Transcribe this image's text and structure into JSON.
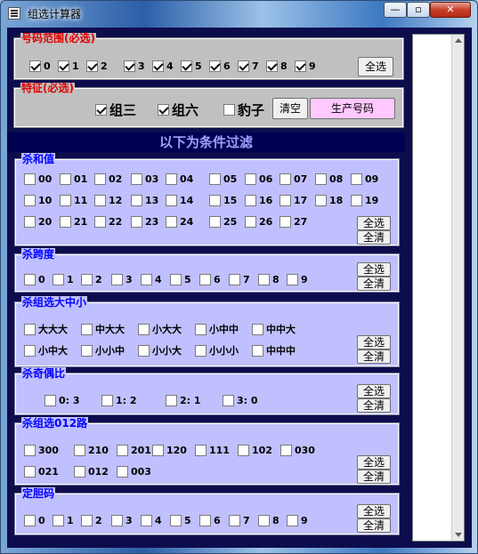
{
  "window": {
    "title": "组选计算器",
    "min_icon": "minimize-icon",
    "max_icon": "maximize-icon",
    "close_icon": "close-icon",
    "min_glyph": "—",
    "max_glyph": "▫",
    "close_glyph": "✕"
  },
  "number_range": {
    "legend": "号码范围(必选)",
    "items": [
      {
        "label": "0",
        "checked": true
      },
      {
        "label": "1",
        "checked": true
      },
      {
        "label": "2",
        "checked": true
      },
      {
        "label": "3",
        "checked": true
      },
      {
        "label": "4",
        "checked": true
      },
      {
        "label": "5",
        "checked": true
      },
      {
        "label": "6",
        "checked": true
      },
      {
        "label": "7",
        "checked": true
      },
      {
        "label": "8",
        "checked": true
      },
      {
        "label": "9",
        "checked": true
      }
    ],
    "select_all": "全选"
  },
  "feature": {
    "legend": "特征(必选)",
    "items": [
      {
        "label": "组三",
        "checked": true
      },
      {
        "label": "组六",
        "checked": true
      },
      {
        "label": "豹子",
        "checked": false
      }
    ],
    "clear": "清空",
    "generate": "生产号码"
  },
  "filter_header": "以下为条件过滤",
  "sum": {
    "legend": "杀和值",
    "items": [
      "00",
      "01",
      "02",
      "03",
      "04",
      "05",
      "06",
      "07",
      "08",
      "09",
      "10",
      "11",
      "12",
      "13",
      "14",
      "15",
      "16",
      "17",
      "18",
      "19",
      "20",
      "21",
      "22",
      "23",
      "24",
      "25",
      "26",
      "27"
    ],
    "select_all": "全选",
    "clear_all": "全清"
  },
  "span": {
    "legend": "杀跨度",
    "items": [
      "0",
      "1",
      "2",
      "3",
      "4",
      "5",
      "6",
      "7",
      "8",
      "9"
    ],
    "select_all": "全选",
    "clear_all": "全清"
  },
  "size": {
    "legend": "杀组选大中小",
    "row1": [
      "大大大",
      "中大大",
      "小大大",
      "小中中",
      "中中大"
    ],
    "row2": [
      "小中大",
      "小小中",
      "小小大",
      "小小小",
      "中中中"
    ],
    "select_all": "全选",
    "clear_all": "全清"
  },
  "parity": {
    "legend": "杀奇偶比",
    "items": [
      "0: 3",
      "1: 2",
      "2: 1",
      "3: 0"
    ],
    "select_all": "全选",
    "clear_all": "全清"
  },
  "route": {
    "legend": "杀组选012路",
    "row1": [
      "300",
      "210",
      "201",
      "120",
      "111",
      "102",
      "030"
    ],
    "row2": [
      "021",
      "012",
      "003"
    ],
    "select_all": "全选",
    "clear_all": "全清"
  },
  "dan": {
    "legend": "定胆码",
    "items": [
      "0",
      "1",
      "2",
      "3",
      "4",
      "5",
      "6",
      "7",
      "8",
      "9"
    ],
    "select_all": "全选",
    "clear_all": "全清"
  }
}
